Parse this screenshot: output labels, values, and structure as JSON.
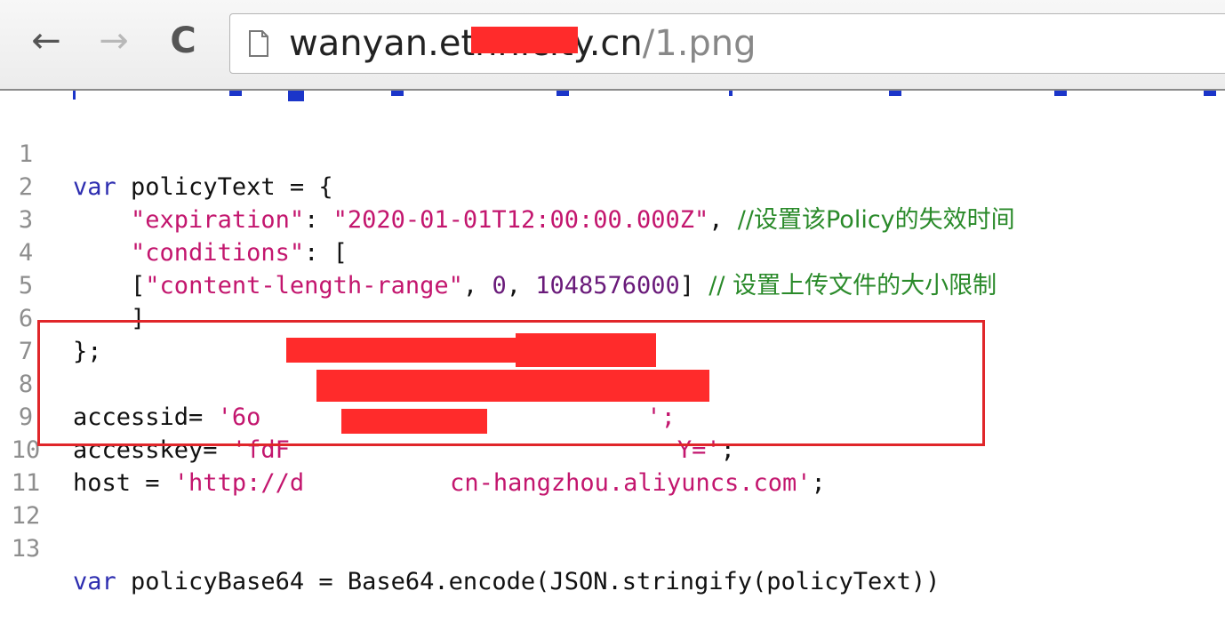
{
  "browser": {
    "nav": {
      "back": "←",
      "forward": "→",
      "reload": "C"
    },
    "url": {
      "host": "wanyan.ethnicity.cn",
      "path": "/1.png"
    }
  },
  "colors": {
    "keyword": "#2d2db0",
    "string": "#c3166e",
    "comment": "#2a8a2a",
    "redaction": "#ff2b2b",
    "highlight_border": "#e0262a"
  },
  "editor": {
    "lines": [
      {
        "n": "1",
        "kw": "var",
        "text": " policyText = {"
      },
      {
        "n": "2",
        "indent": "    ",
        "key": "\"expiration\"",
        "sep": ": ",
        "val": "\"2020-01-01T12:00:00.000Z\"",
        "after": ", ",
        "comment": "//设置该Policy的失效时间"
      },
      {
        "n": "3",
        "indent": "    ",
        "key": "\"conditions\"",
        "after": ": ["
      },
      {
        "n": "4",
        "indent": "    ",
        "open": "[",
        "val": "\"content-length-range\"",
        "mid": ", ",
        "num1": "0",
        "mid2": ", ",
        "num2": "1048576000",
        "close": "] ",
        "comment": "// 设置上传文件的大小限制"
      },
      {
        "n": "5",
        "text": "    ]"
      },
      {
        "n": "6",
        "text": "};"
      },
      {
        "n": "7",
        "text": ""
      },
      {
        "n": "8",
        "text": "accessid= ",
        "val": "'6o",
        "end": "';"
      },
      {
        "n": "9",
        "text": "accesskey= ",
        "val": "'fdF",
        "val2": "Y='",
        "end": ";"
      },
      {
        "n": "10",
        "text": "host = ",
        "val": "'http://d",
        "val2": "cn-hangzhou.aliyuncs.com'",
        "end": ";"
      },
      {
        "n": "11",
        "text": ""
      },
      {
        "n": "12",
        "text": ""
      },
      {
        "n": "13",
        "kw": "var",
        "text": " policyBase64 = Base64.encode(JSON.stringify(policyText))"
      }
    ]
  }
}
